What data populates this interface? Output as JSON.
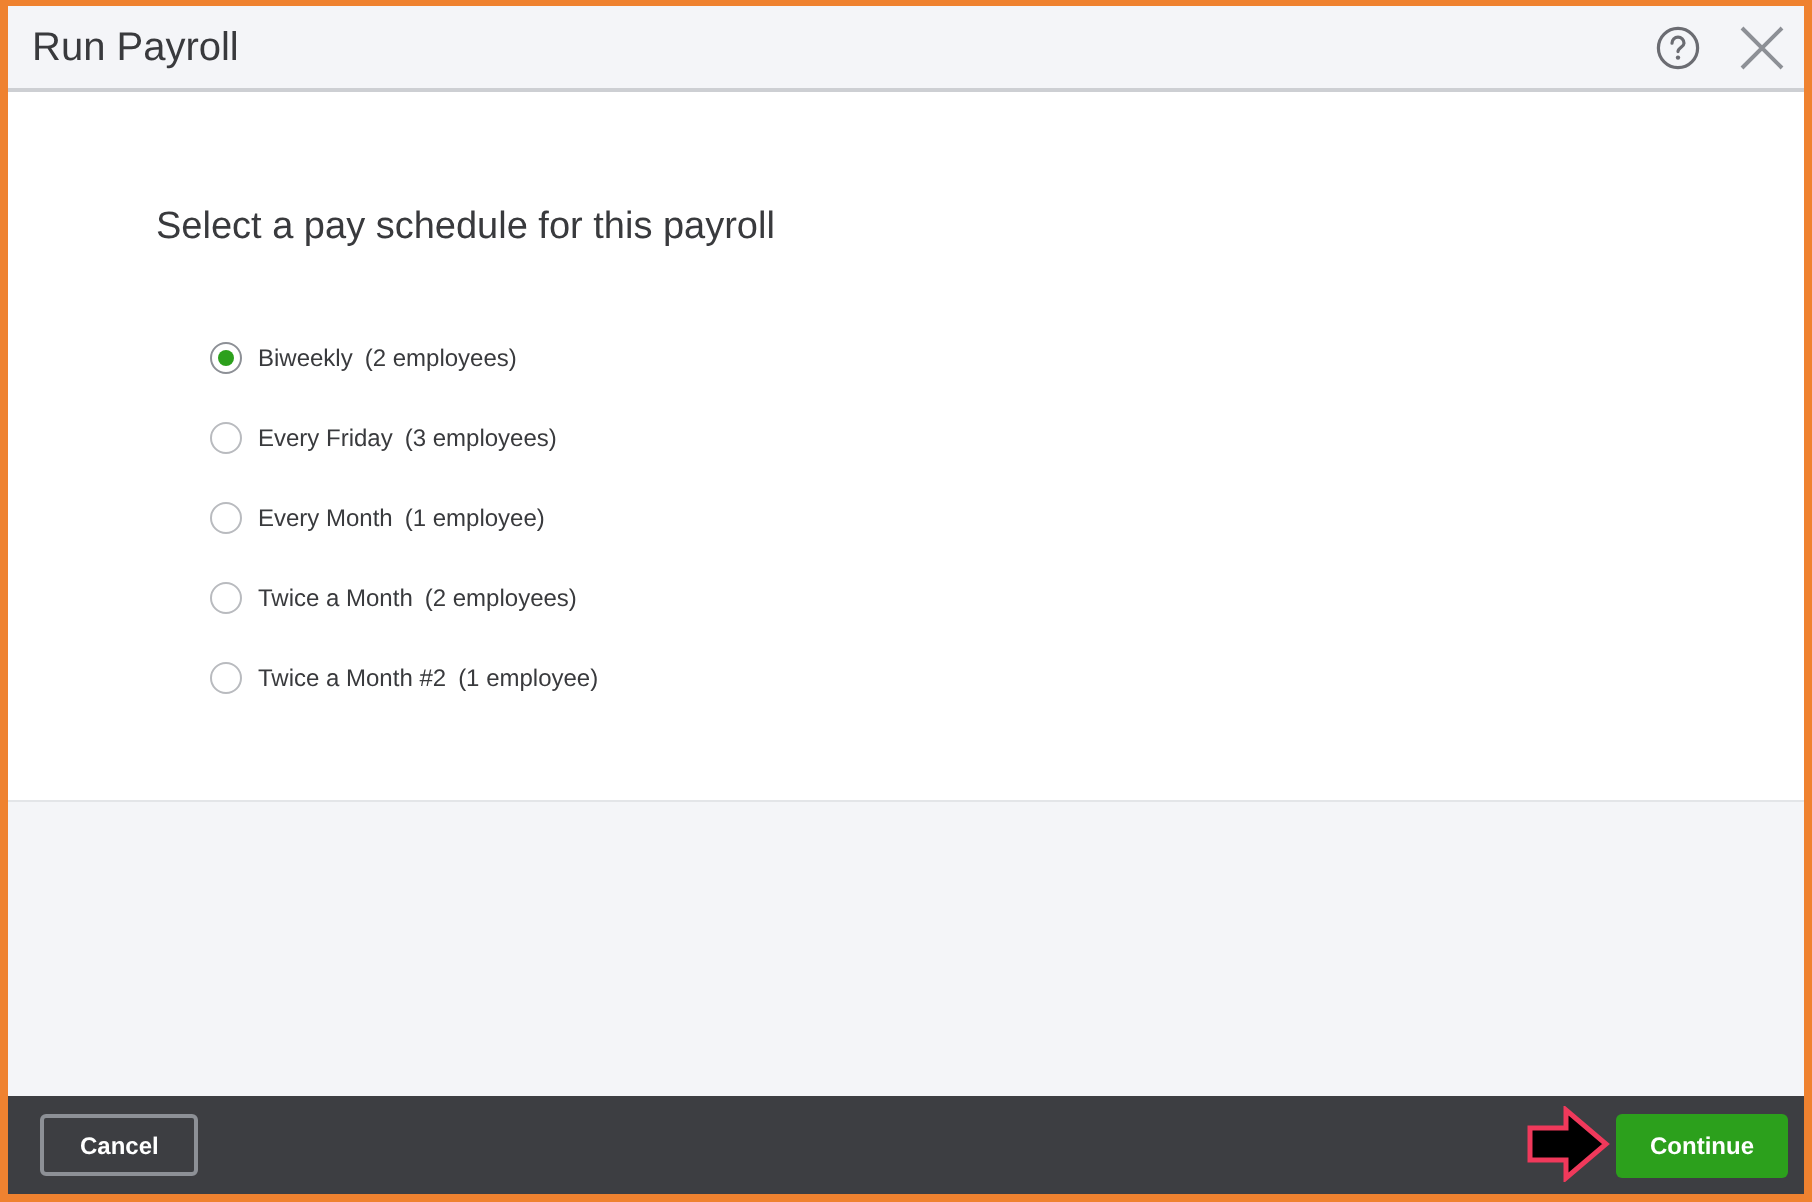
{
  "window": {
    "title": "Run Payroll"
  },
  "prompt": "Select a pay schedule for this payroll",
  "pay_schedules": [
    {
      "label": "Biweekly",
      "count": "(2 employees)",
      "selected": true
    },
    {
      "label": "Every Friday",
      "count": "(3 employees)",
      "selected": false
    },
    {
      "label": "Every Month",
      "count": "(1 employee)",
      "selected": false
    },
    {
      "label": "Twice a Month",
      "count": "(2 employees)",
      "selected": false
    },
    {
      "label": "Twice a Month #2",
      "count": "(1 employee)",
      "selected": false
    }
  ],
  "footer": {
    "buttons": [
      {
        "label": "Cancel",
        "kind": "secondary"
      },
      {
        "label": "Continue",
        "kind": "primary"
      }
    ]
  }
}
